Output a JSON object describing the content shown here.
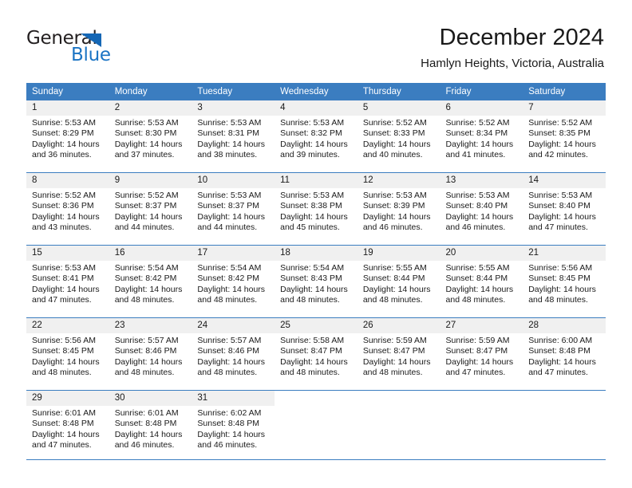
{
  "brand": {
    "name_part1": "General",
    "name_part2": "Blue",
    "triangle_icon": "triangle-icon",
    "primary_color": "#1b74c4",
    "header_color": "#3b7dc0"
  },
  "header": {
    "title": "December 2024",
    "subtitle": "Hamlyn Heights, Victoria, Australia"
  },
  "calendar": {
    "weekday_headers": [
      "Sunday",
      "Monday",
      "Tuesday",
      "Wednesday",
      "Thursday",
      "Friday",
      "Saturday"
    ],
    "weeks": [
      [
        {
          "day": "1",
          "sunrise": "Sunrise: 5:53 AM",
          "sunset": "Sunset: 8:29 PM",
          "daylight_line1": "Daylight: 14 hours",
          "daylight_line2": "and 36 minutes."
        },
        {
          "day": "2",
          "sunrise": "Sunrise: 5:53 AM",
          "sunset": "Sunset: 8:30 PM",
          "daylight_line1": "Daylight: 14 hours",
          "daylight_line2": "and 37 minutes."
        },
        {
          "day": "3",
          "sunrise": "Sunrise: 5:53 AM",
          "sunset": "Sunset: 8:31 PM",
          "daylight_line1": "Daylight: 14 hours",
          "daylight_line2": "and 38 minutes."
        },
        {
          "day": "4",
          "sunrise": "Sunrise: 5:53 AM",
          "sunset": "Sunset: 8:32 PM",
          "daylight_line1": "Daylight: 14 hours",
          "daylight_line2": "and 39 minutes."
        },
        {
          "day": "5",
          "sunrise": "Sunrise: 5:52 AM",
          "sunset": "Sunset: 8:33 PM",
          "daylight_line1": "Daylight: 14 hours",
          "daylight_line2": "and 40 minutes."
        },
        {
          "day": "6",
          "sunrise": "Sunrise: 5:52 AM",
          "sunset": "Sunset: 8:34 PM",
          "daylight_line1": "Daylight: 14 hours",
          "daylight_line2": "and 41 minutes."
        },
        {
          "day": "7",
          "sunrise": "Sunrise: 5:52 AM",
          "sunset": "Sunset: 8:35 PM",
          "daylight_line1": "Daylight: 14 hours",
          "daylight_line2": "and 42 minutes."
        }
      ],
      [
        {
          "day": "8",
          "sunrise": "Sunrise: 5:52 AM",
          "sunset": "Sunset: 8:36 PM",
          "daylight_line1": "Daylight: 14 hours",
          "daylight_line2": "and 43 minutes."
        },
        {
          "day": "9",
          "sunrise": "Sunrise: 5:52 AM",
          "sunset": "Sunset: 8:37 PM",
          "daylight_line1": "Daylight: 14 hours",
          "daylight_line2": "and 44 minutes."
        },
        {
          "day": "10",
          "sunrise": "Sunrise: 5:53 AM",
          "sunset": "Sunset: 8:37 PM",
          "daylight_line1": "Daylight: 14 hours",
          "daylight_line2": "and 44 minutes."
        },
        {
          "day": "11",
          "sunrise": "Sunrise: 5:53 AM",
          "sunset": "Sunset: 8:38 PM",
          "daylight_line1": "Daylight: 14 hours",
          "daylight_line2": "and 45 minutes."
        },
        {
          "day": "12",
          "sunrise": "Sunrise: 5:53 AM",
          "sunset": "Sunset: 8:39 PM",
          "daylight_line1": "Daylight: 14 hours",
          "daylight_line2": "and 46 minutes."
        },
        {
          "day": "13",
          "sunrise": "Sunrise: 5:53 AM",
          "sunset": "Sunset: 8:40 PM",
          "daylight_line1": "Daylight: 14 hours",
          "daylight_line2": "and 46 minutes."
        },
        {
          "day": "14",
          "sunrise": "Sunrise: 5:53 AM",
          "sunset": "Sunset: 8:40 PM",
          "daylight_line1": "Daylight: 14 hours",
          "daylight_line2": "and 47 minutes."
        }
      ],
      [
        {
          "day": "15",
          "sunrise": "Sunrise: 5:53 AM",
          "sunset": "Sunset: 8:41 PM",
          "daylight_line1": "Daylight: 14 hours",
          "daylight_line2": "and 47 minutes."
        },
        {
          "day": "16",
          "sunrise": "Sunrise: 5:54 AM",
          "sunset": "Sunset: 8:42 PM",
          "daylight_line1": "Daylight: 14 hours",
          "daylight_line2": "and 48 minutes."
        },
        {
          "day": "17",
          "sunrise": "Sunrise: 5:54 AM",
          "sunset": "Sunset: 8:42 PM",
          "daylight_line1": "Daylight: 14 hours",
          "daylight_line2": "and 48 minutes."
        },
        {
          "day": "18",
          "sunrise": "Sunrise: 5:54 AM",
          "sunset": "Sunset: 8:43 PM",
          "daylight_line1": "Daylight: 14 hours",
          "daylight_line2": "and 48 minutes."
        },
        {
          "day": "19",
          "sunrise": "Sunrise: 5:55 AM",
          "sunset": "Sunset: 8:44 PM",
          "daylight_line1": "Daylight: 14 hours",
          "daylight_line2": "and 48 minutes."
        },
        {
          "day": "20",
          "sunrise": "Sunrise: 5:55 AM",
          "sunset": "Sunset: 8:44 PM",
          "daylight_line1": "Daylight: 14 hours",
          "daylight_line2": "and 48 minutes."
        },
        {
          "day": "21",
          "sunrise": "Sunrise: 5:56 AM",
          "sunset": "Sunset: 8:45 PM",
          "daylight_line1": "Daylight: 14 hours",
          "daylight_line2": "and 48 minutes."
        }
      ],
      [
        {
          "day": "22",
          "sunrise": "Sunrise: 5:56 AM",
          "sunset": "Sunset: 8:45 PM",
          "daylight_line1": "Daylight: 14 hours",
          "daylight_line2": "and 48 minutes."
        },
        {
          "day": "23",
          "sunrise": "Sunrise: 5:57 AM",
          "sunset": "Sunset: 8:46 PM",
          "daylight_line1": "Daylight: 14 hours",
          "daylight_line2": "and 48 minutes."
        },
        {
          "day": "24",
          "sunrise": "Sunrise: 5:57 AM",
          "sunset": "Sunset: 8:46 PM",
          "daylight_line1": "Daylight: 14 hours",
          "daylight_line2": "and 48 minutes."
        },
        {
          "day": "25",
          "sunrise": "Sunrise: 5:58 AM",
          "sunset": "Sunset: 8:47 PM",
          "daylight_line1": "Daylight: 14 hours",
          "daylight_line2": "and 48 minutes."
        },
        {
          "day": "26",
          "sunrise": "Sunrise: 5:59 AM",
          "sunset": "Sunset: 8:47 PM",
          "daylight_line1": "Daylight: 14 hours",
          "daylight_line2": "and 48 minutes."
        },
        {
          "day": "27",
          "sunrise": "Sunrise: 5:59 AM",
          "sunset": "Sunset: 8:47 PM",
          "daylight_line1": "Daylight: 14 hours",
          "daylight_line2": "and 47 minutes."
        },
        {
          "day": "28",
          "sunrise": "Sunrise: 6:00 AM",
          "sunset": "Sunset: 8:48 PM",
          "daylight_line1": "Daylight: 14 hours",
          "daylight_line2": "and 47 minutes."
        }
      ],
      [
        {
          "day": "29",
          "sunrise": "Sunrise: 6:01 AM",
          "sunset": "Sunset: 8:48 PM",
          "daylight_line1": "Daylight: 14 hours",
          "daylight_line2": "and 47 minutes."
        },
        {
          "day": "30",
          "sunrise": "Sunrise: 6:01 AM",
          "sunset": "Sunset: 8:48 PM",
          "daylight_line1": "Daylight: 14 hours",
          "daylight_line2": "and 46 minutes."
        },
        {
          "day": "31",
          "sunrise": "Sunrise: 6:02 AM",
          "sunset": "Sunset: 8:48 PM",
          "daylight_line1": "Daylight: 14 hours",
          "daylight_line2": "and 46 minutes."
        },
        {
          "day": "",
          "sunrise": "",
          "sunset": "",
          "daylight_line1": "",
          "daylight_line2": ""
        },
        {
          "day": "",
          "sunrise": "",
          "sunset": "",
          "daylight_line1": "",
          "daylight_line2": ""
        },
        {
          "day": "",
          "sunrise": "",
          "sunset": "",
          "daylight_line1": "",
          "daylight_line2": ""
        },
        {
          "day": "",
          "sunrise": "",
          "sunset": "",
          "daylight_line1": "",
          "daylight_line2": ""
        }
      ]
    ]
  }
}
